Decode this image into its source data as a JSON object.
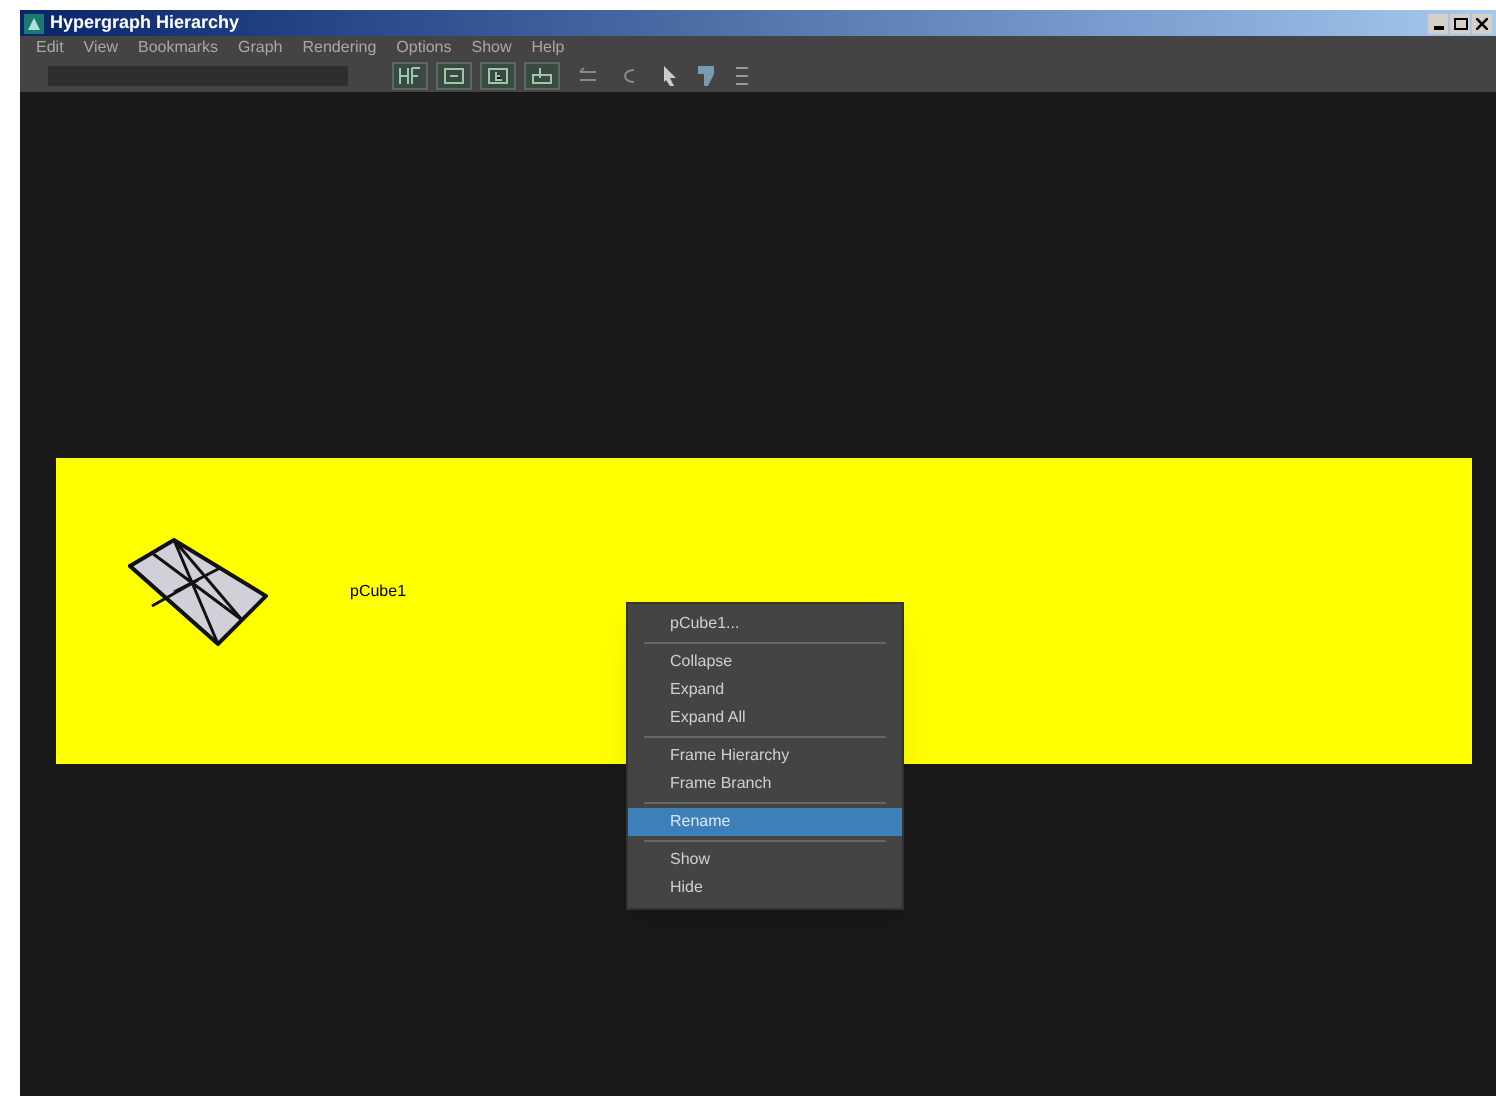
{
  "window": {
    "title": "Hypergraph Hierarchy"
  },
  "menu_bar": [
    "Edit",
    "View",
    "Bookmarks",
    "Graph",
    "Rendering",
    "Options",
    "Show",
    "Help"
  ],
  "node": {
    "label": "pCube1"
  },
  "context_menu": {
    "items": [
      {
        "kind": "item",
        "label": "pCube1...",
        "selected": false
      },
      {
        "kind": "separator"
      },
      {
        "kind": "item",
        "label": "Collapse",
        "selected": false
      },
      {
        "kind": "item",
        "label": "Expand",
        "selected": false
      },
      {
        "kind": "item",
        "label": "Expand All",
        "selected": false
      },
      {
        "kind": "separator"
      },
      {
        "kind": "item",
        "label": "Frame Hierarchy",
        "selected": false
      },
      {
        "kind": "item",
        "label": "Frame Branch",
        "selected": false
      },
      {
        "kind": "separator"
      },
      {
        "kind": "item",
        "label": "Rename",
        "selected": true
      },
      {
        "kind": "separator"
      },
      {
        "kind": "item",
        "label": "Show",
        "selected": false
      },
      {
        "kind": "item",
        "label": "Hide",
        "selected": false
      }
    ]
  }
}
